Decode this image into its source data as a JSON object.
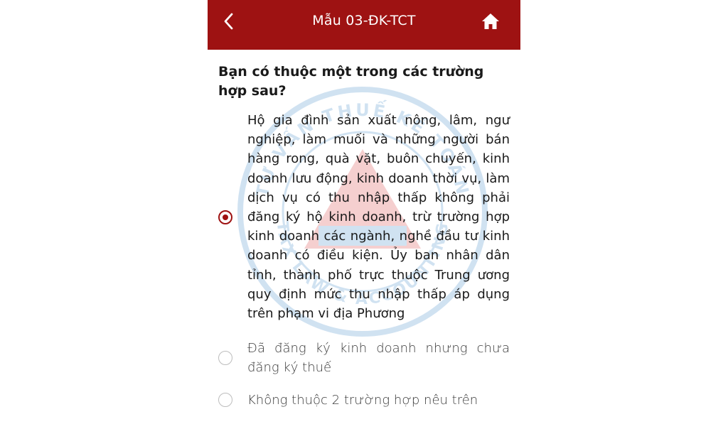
{
  "header": {
    "title": "Mẫu 03-ĐK-TCT",
    "back_icon": "chevron-left-icon",
    "home_icon": "home-icon",
    "background_color": "#9e1212",
    "text_color": "#ffffff"
  },
  "watermark": {
    "text_top": "TƯ VẤN THUẾ KẾ TOÁN",
    "text_bottom": "TAX LAW & ACCOUNTING"
  },
  "question": {
    "text": "Bạn có thuộc một trong các trường hợp sau?"
  },
  "options": [
    {
      "label": "Hộ gia đình sản xuất nông, lâm, ngư nghiệp, làm muối và những người bán hàng rong, quà vặt, buôn chuyến, kinh doanh lưu động, kinh doanh thời vụ, làm dịch vụ có thu nhập thấp không phải đăng ký hộ kinh doanh, trừ trường hợp kinh doanh các ngành, nghề đầu tư kinh doanh có điều kiện. Ủy ban nhân dân tỉnh, thành phố trực thuộc Trung ương quy định mức thu nhập thấp áp dụng trên phạm vi địa Phương",
      "selected": true
    },
    {
      "label": "Đã đăng ký kinh doanh nhưng chưa đăng ký thuế",
      "selected": false
    },
    {
      "label": "Không thuộc 2 trường hợp nêu trên",
      "selected": false
    }
  ],
  "colors": {
    "accent": "#9e1212",
    "radio_unselected_border": "#bdbdbd"
  }
}
